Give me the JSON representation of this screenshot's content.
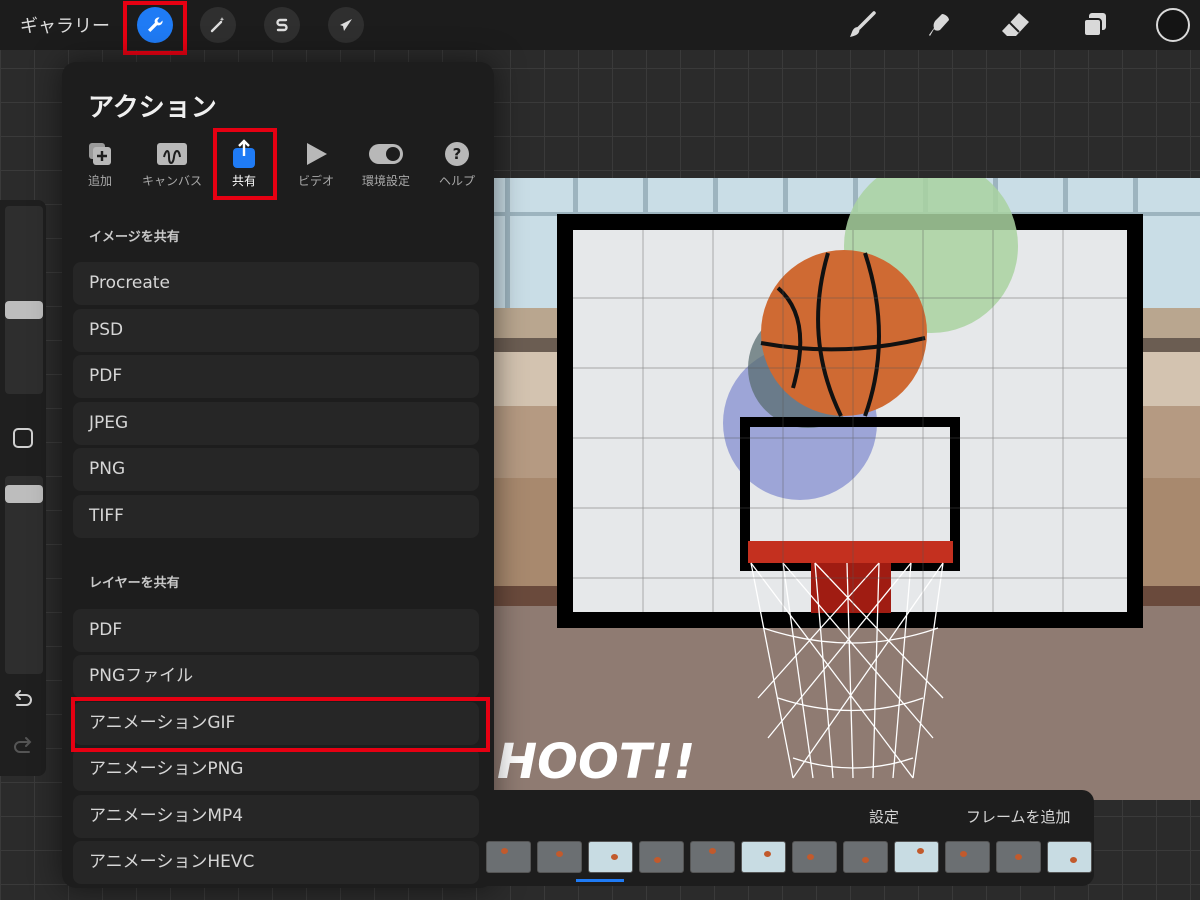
{
  "topbar": {
    "gallery_label": "ギャラリー",
    "left_tools": [
      "wrench-icon",
      "magic-wand-icon",
      "selection-s-icon",
      "arrow-transform-icon"
    ],
    "right_tools": [
      "brush-icon",
      "smudge-icon",
      "eraser-icon",
      "layers-icon",
      "color-circle"
    ]
  },
  "panel": {
    "title": "アクション",
    "tabs": [
      {
        "label": "追加",
        "icon": "add-icon"
      },
      {
        "label": "キャンバス",
        "icon": "canvas-icon"
      },
      {
        "label": "共有",
        "icon": "share-icon",
        "active": true
      },
      {
        "label": "ビデオ",
        "icon": "play-icon"
      },
      {
        "label": "環境設定",
        "icon": "toggle-icon"
      },
      {
        "label": "ヘルプ",
        "icon": "help-icon"
      }
    ],
    "image_section": "イメージを共有",
    "image_items": [
      "Procreate",
      "PSD",
      "PDF",
      "JPEG",
      "PNG",
      "TIFF"
    ],
    "layer_section": "レイヤーを共有",
    "layer_items": [
      "PDF",
      "PNGファイル",
      "アニメーションGIF",
      "アニメーションPNG",
      "アニメーションMP4",
      "アニメーションHEVC"
    ]
  },
  "canvas": {
    "shoot_text": "HOOT!!"
  },
  "timeline": {
    "settings_label": "設定",
    "add_frame_label": "フレームを追加",
    "frame_count": 12
  },
  "colors": {
    "accent": "#1f7bf5",
    "highlight": "#e60012"
  }
}
